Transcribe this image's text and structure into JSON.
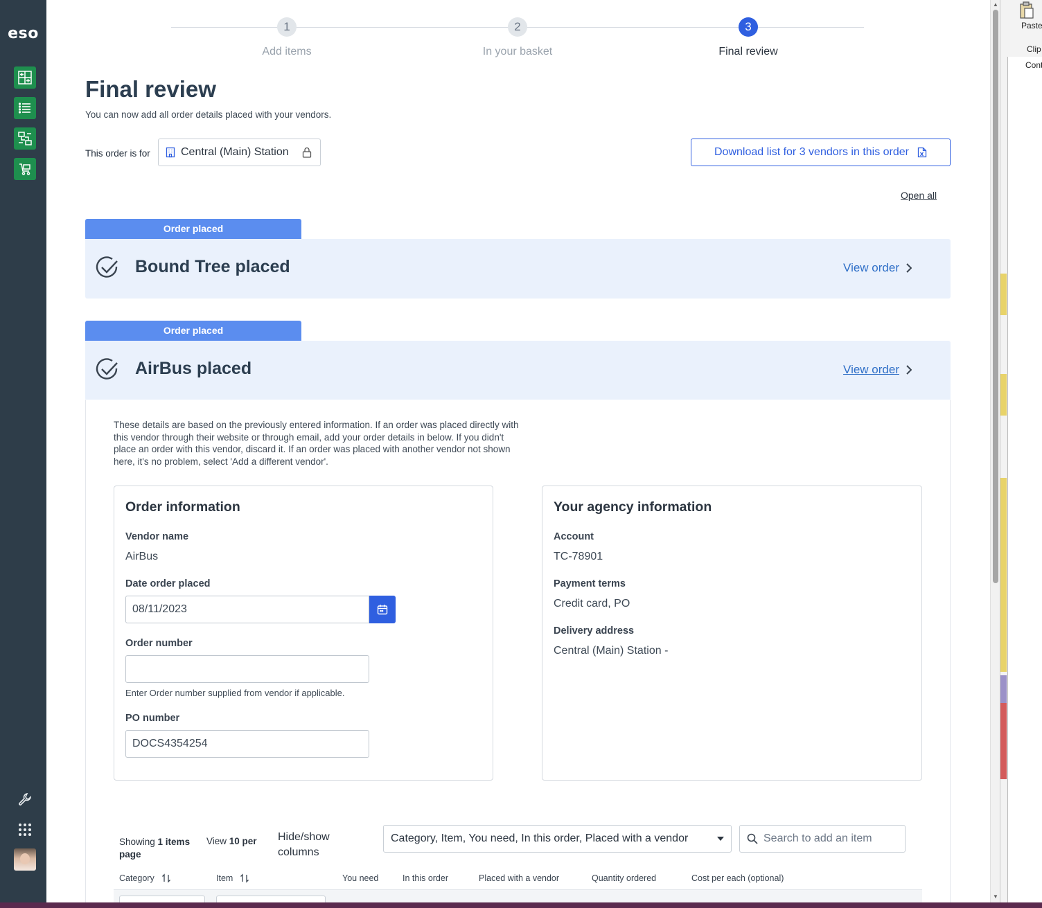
{
  "nav": {
    "logo": "eso",
    "items": [
      {
        "icon": "add-grid-icon"
      },
      {
        "icon": "list-icon"
      },
      {
        "icon": "transfer-icon"
      },
      {
        "icon": "cart-icon"
      }
    ],
    "utilities": [
      {
        "icon": "wrench-icon"
      },
      {
        "icon": "apps-grid-icon"
      },
      {
        "icon": "user-avatar"
      }
    ],
    "accent": "#1e8f4e",
    "background": "#2e3d49"
  },
  "stepper": {
    "steps": [
      {
        "number": "1",
        "label": "Add items"
      },
      {
        "number": "2",
        "label": "In your basket"
      },
      {
        "number": "3",
        "label": "Final review"
      }
    ],
    "active_step": 3,
    "active_color": "#2f5fe0"
  },
  "page": {
    "title": "Final review",
    "subtitle": "You can now add all order details placed with your vendors.",
    "order_for_label": "This order is for",
    "station": "Central (Main) Station",
    "download_label": "Download list for 3 vendors in this order",
    "open_all": "Open all"
  },
  "vendors": [
    {
      "badge": "Order placed",
      "title": "Bound Tree placed",
      "view_label": "View order"
    },
    {
      "badge": "Order placed",
      "title": "AirBus placed",
      "view_label": "View order"
    }
  ],
  "details": {
    "intro": "These details are based on the previously entered information. If an order was placed directly with this vendor through their website or through email, add your order details in below. If you didn't place an order with this vendor, discard it. If an order was placed with another vendor not shown here, it's no problem, select 'Add a different vendor'.",
    "order_info": {
      "heading": "Order information",
      "vendor_name_label": "Vendor name",
      "vendor_name": "AirBus",
      "date_label": "Date order placed",
      "date_value": "08/11/2023",
      "order_number_label": "Order number",
      "order_number_value": "",
      "order_number_hint": "Enter Order number supplied from vendor if applicable.",
      "po_label": "PO number",
      "po_value": "DOCS4354254"
    },
    "agency_info": {
      "heading": "Your agency information",
      "account_label": "Account",
      "account": "TC-78901",
      "payment_label": "Payment terms",
      "payment": "Credit card, PO",
      "address_label": "Delivery address",
      "address": "Central (Main) Station -"
    }
  },
  "table": {
    "showing_prefix": "Showing ",
    "showing_count": "1 items",
    "showing_suffix": "page",
    "view_prefix": "View ",
    "view_count": "10 per",
    "hide_show": "Hide/show columns",
    "columns_select": "Category, Item, You need, In this order, Placed with a vendor",
    "search_placeholder": "Search to add an item",
    "headers": [
      "Category",
      "Item",
      "You need",
      "In this order",
      "Placed with a vendor",
      "Quantity ordered",
      "Cost per each (optional)"
    ]
  },
  "background_window": {
    "paste_label": "Paste",
    "clip_label": "Clip",
    "cont_label": "Cont"
  }
}
